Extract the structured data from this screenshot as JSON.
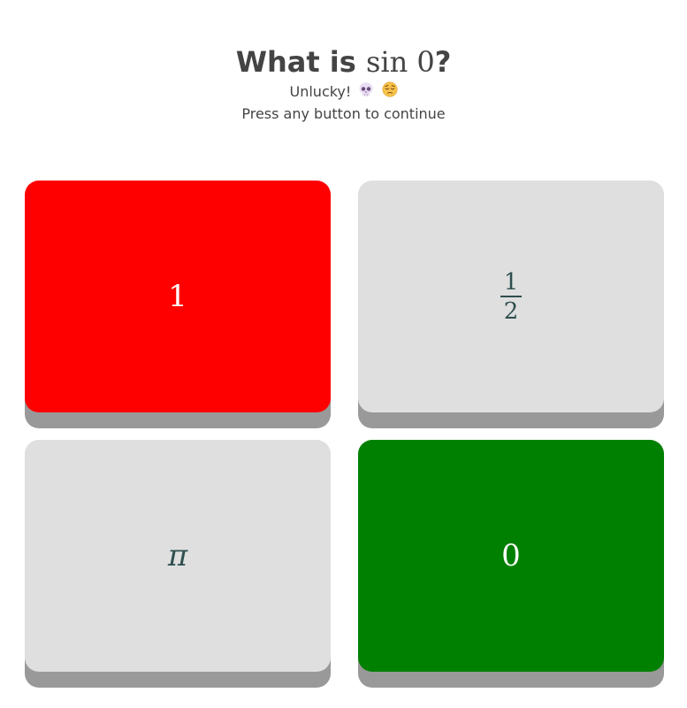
{
  "question": {
    "prefix": "What is ",
    "math": "sin 0",
    "suffix": "?"
  },
  "feedback": {
    "text": "Unlucky!",
    "emoji_1": "skull-emoji",
    "emoji_2": "pensive-face-emoji"
  },
  "instruction": "Press any button to continue",
  "answers": [
    {
      "label": "1",
      "state": "wrong",
      "color": "#ff0000"
    },
    {
      "numerator": "1",
      "denominator": "2",
      "state": "neutral",
      "color": "#dfdfdf"
    },
    {
      "label": "π",
      "state": "neutral",
      "color": "#dfdfdf"
    },
    {
      "label": "0",
      "state": "correct",
      "color": "#008000"
    }
  ],
  "colors": {
    "shadow": "#999999",
    "neutral_text": "#2f4f4f",
    "heading_text": "#444444"
  }
}
